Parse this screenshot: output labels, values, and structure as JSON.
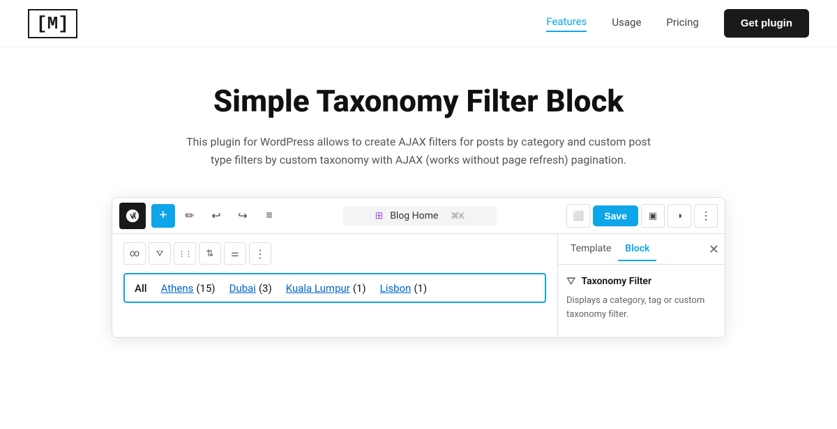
{
  "header": {
    "logo": "[M]",
    "nav": [
      {
        "label": "Features",
        "active": true
      },
      {
        "label": "Usage",
        "active": false
      },
      {
        "label": "Pricing",
        "active": false
      }
    ],
    "cta_label": "Get plugin"
  },
  "hero": {
    "title": "Simple Taxonomy Filter Block",
    "description": "This plugin for WordPress allows to create AJAX filters for posts by category and custom post type filters by custom taxonomy with AJAX (works without page refresh) pagination."
  },
  "editor": {
    "toolbar": {
      "plus_label": "+",
      "blog_home_label": "Blog Home",
      "shortcut_label": "⌘K",
      "save_label": "Save"
    },
    "filter_items": [
      {
        "label": "All",
        "count": null,
        "link": false
      },
      {
        "label": "Athens",
        "count": "(15)",
        "link": true
      },
      {
        "label": "Dubai",
        "count": "(3)",
        "link": true
      },
      {
        "label": "Kuala Lumpur",
        "count": "(1)",
        "link": true
      },
      {
        "label": "Lisbon",
        "count": "(1)",
        "link": true
      }
    ],
    "panel": {
      "tab_template": "Template",
      "tab_block": "Block",
      "block_name": "Taxonomy Filter",
      "block_description": "Displays a category, tag or custom taxonomy filter."
    }
  }
}
